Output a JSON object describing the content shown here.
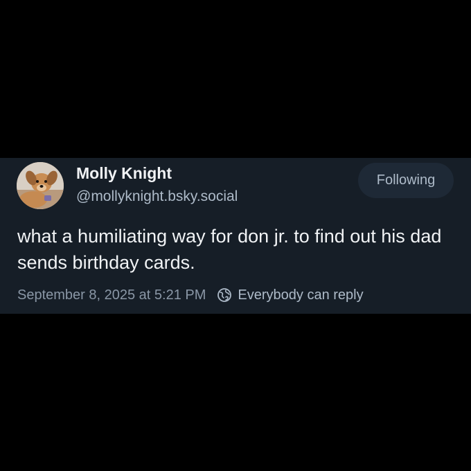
{
  "post": {
    "author": {
      "display_name": "Molly Knight",
      "handle": "@mollyknight.bsky.social",
      "avatar_icon": "dog-avatar"
    },
    "follow_button_label": "Following",
    "text": "what a humiliating way for don jr. to find out his dad sends birthday cards.",
    "timestamp": "September 8, 2025 at 5:21 PM",
    "reply_setting": {
      "icon": "globe-icon",
      "label": "Everybody can reply"
    }
  },
  "colors": {
    "page_background": "#000000",
    "card_background": "#161e27",
    "primary_text": "#f1f3f5",
    "secondary_text": "#aebbc9",
    "muted_text": "#8a97a6",
    "button_background": "#1e2936"
  }
}
